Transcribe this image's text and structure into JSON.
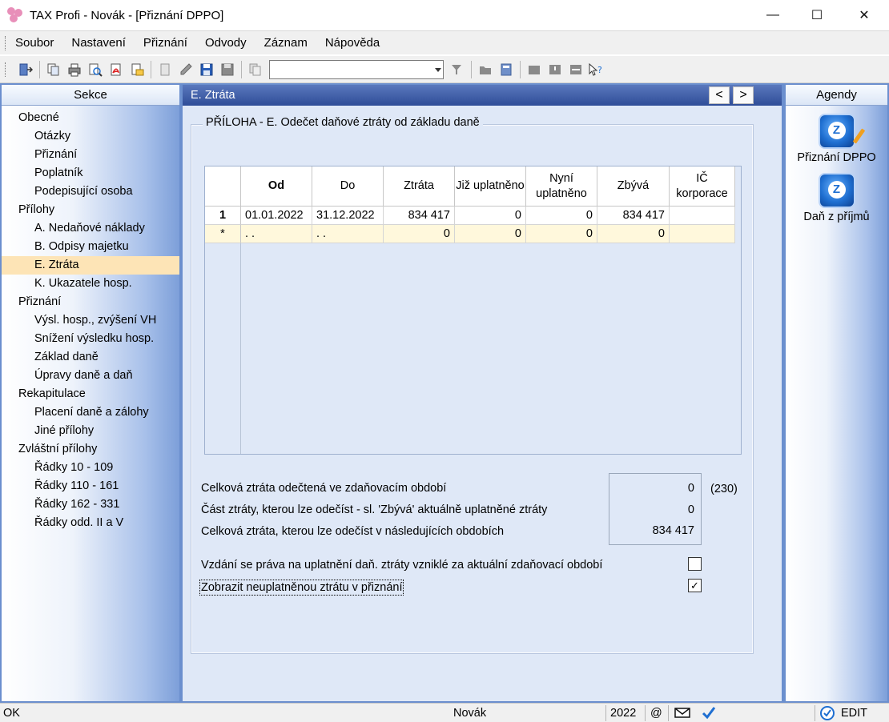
{
  "window": {
    "title": "TAX Profi - Novák - [Přiznání DPPO]",
    "minimize": "—",
    "maximize": "☐",
    "close": "✕"
  },
  "menu": [
    {
      "label": "Soubor"
    },
    {
      "label": "Nastavení"
    },
    {
      "label": "Přiznání"
    },
    {
      "label": "Odvody"
    },
    {
      "label": "Záznam"
    },
    {
      "label": "Nápověda"
    }
  ],
  "toolbar": {
    "combo_value": ""
  },
  "sekce": {
    "title": "Sekce",
    "items": [
      {
        "label": "Obecné",
        "level": 1
      },
      {
        "label": "Otázky",
        "level": 2
      },
      {
        "label": "Přiznání",
        "level": 2
      },
      {
        "label": "Poplatník",
        "level": 2
      },
      {
        "label": "Podepisující osoba",
        "level": 2
      },
      {
        "label": "Přílohy",
        "level": 1
      },
      {
        "label": "A. Nedaňové náklady",
        "level": 2
      },
      {
        "label": "B. Odpisy majetku",
        "level": 2
      },
      {
        "label": "E. Ztráta",
        "level": 2,
        "selected": true
      },
      {
        "label": "K. Ukazatele hosp.",
        "level": 2
      },
      {
        "label": "Přiznání",
        "level": 1
      },
      {
        "label": "Výsl. hosp., zvýšení VH",
        "level": 2
      },
      {
        "label": "Snížení výsledku hosp.",
        "level": 2
      },
      {
        "label": "Základ daně",
        "level": 2
      },
      {
        "label": "Úpravy daně a daň",
        "level": 2
      },
      {
        "label": "Rekapitulace",
        "level": 1
      },
      {
        "label": "Placení daně a zálohy",
        "level": 2
      },
      {
        "label": "Jiné přílohy",
        "level": 2
      },
      {
        "label": "Zvláštní přílohy",
        "level": 1
      },
      {
        "label": "Řádky 10 - 109",
        "level": 2
      },
      {
        "label": "Řádky 110 - 161",
        "level": 2
      },
      {
        "label": "Řádky 162 - 331",
        "level": 2
      },
      {
        "label": "Řádky odd. II a V",
        "level": 2
      }
    ]
  },
  "content": {
    "title": "E. Ztráta",
    "prev": "<",
    "next": ">",
    "group_title": "PŘÍLOHA - E. Odečet daňové ztráty od základu daně",
    "grid": {
      "columns": [
        "Od",
        "Do",
        "Ztráta",
        "Již uplatněno",
        "Nyní uplatněno",
        "Zbývá",
        "IČ korporace"
      ],
      "rows": [
        {
          "indicator": "1",
          "cells": [
            "01.01.2022",
            "31.12.2022",
            "834 417",
            "0",
            "0",
            "834 417",
            ""
          ]
        },
        {
          "indicator": "*",
          "cells": [
            ". .",
            ". .",
            "0",
            "0",
            "0",
            "0",
            ""
          ]
        }
      ]
    },
    "summary": {
      "labels": [
        "Celková ztráta odečtená ve zdaňovacím období",
        "Část ztráty, kterou lze odečíst - sl. 'Zbývá' aktuálně uplatněné ztráty",
        "Celková ztráta, kterou lze odečíst v následujících obdobích"
      ],
      "values": [
        "0",
        "0",
        "834 417"
      ],
      "ref": "(230)"
    },
    "checks": [
      {
        "label": "Vzdání se práva na uplatnění daň. ztráty vzniklé za aktuální zdaňovací období",
        "checked": false,
        "mark": ""
      },
      {
        "label": "Zobrazit neuplatněnou ztrátu v přiznání",
        "checked": true,
        "mark": "✓"
      }
    ]
  },
  "agendy": {
    "title": "Agendy",
    "items": [
      {
        "label": "Přiznání DPPO"
      },
      {
        "label": "Daň z příjmů"
      }
    ]
  },
  "status": {
    "state": "OK",
    "user": "Novák",
    "year": "2022",
    "at": "@",
    "mode": "EDIT"
  }
}
